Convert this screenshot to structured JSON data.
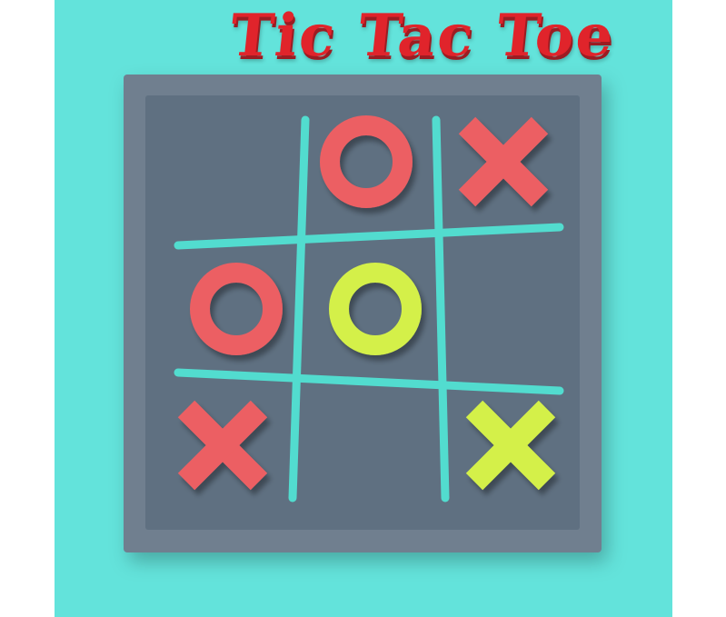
{
  "title": "Tic Tac Toe",
  "colors": {
    "background": "#63e3db",
    "board": "#5f7081",
    "board_rim": "#6f7f8f",
    "grid_lines": "#52dccf",
    "red_piece": "#ec5f63",
    "green_piece": "#d4f048",
    "title": "#e0242b"
  },
  "board": [
    [
      {
        "piece": "",
        "color": ""
      },
      {
        "piece": "O",
        "color": "red"
      },
      {
        "piece": "X",
        "color": "red"
      }
    ],
    [
      {
        "piece": "O",
        "color": "red"
      },
      {
        "piece": "O",
        "color": "green"
      },
      {
        "piece": "",
        "color": ""
      }
    ],
    [
      {
        "piece": "X",
        "color": "red"
      },
      {
        "piece": "",
        "color": ""
      },
      {
        "piece": "X",
        "color": "green"
      }
    ]
  ]
}
